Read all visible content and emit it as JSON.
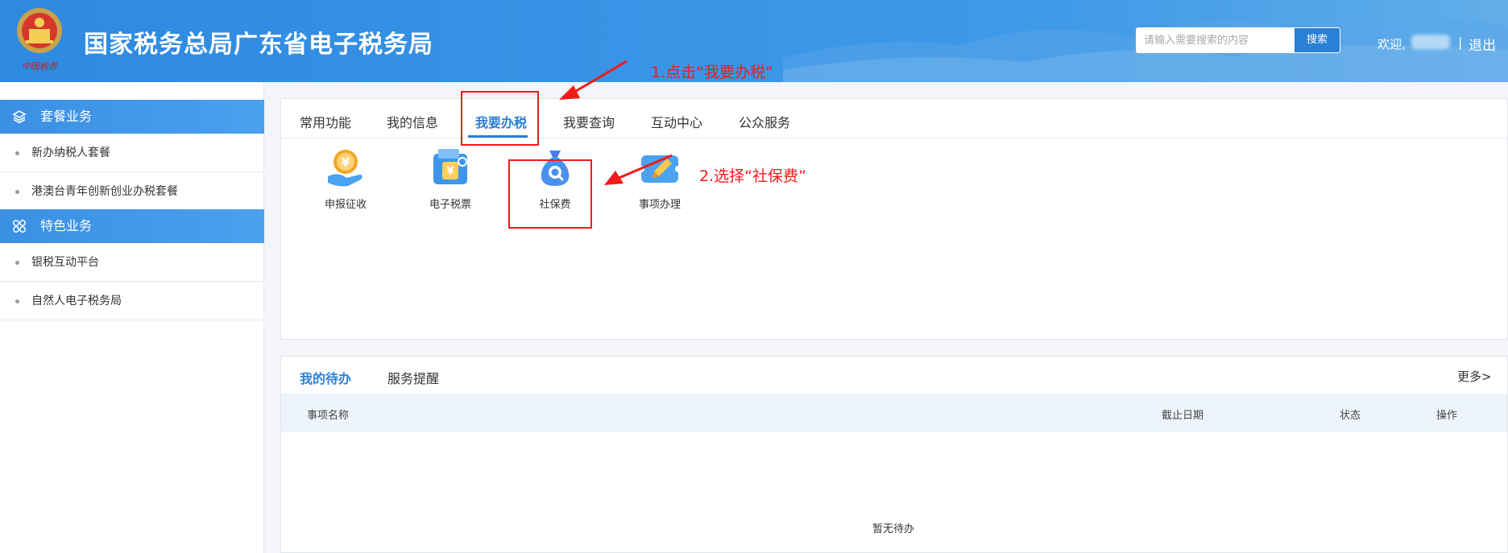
{
  "header": {
    "emblem_caption": "中国税务",
    "title": "国家税务总局广东省电子税务局",
    "search": {
      "placeholder": "请输入需要搜索的内容",
      "button_label": "搜索"
    },
    "welcome": "欢迎,",
    "separator": "|",
    "logout_label": "退出",
    "bg_color": "#3a94e6"
  },
  "sidebar": {
    "sections": [
      {
        "label": "套餐业务",
        "icon": "layers-icon",
        "items": [
          "新办纳税人套餐",
          "港澳台青年创新创业办税套餐"
        ]
      },
      {
        "label": "特色业务",
        "icon": "grid-icon",
        "items": [
          "银税互动平台",
          "自然人电子税务局"
        ]
      }
    ]
  },
  "main": {
    "tabs": [
      {
        "label": "常用功能",
        "active": false
      },
      {
        "label": "我的信息",
        "active": false
      },
      {
        "label": "我要办税",
        "active": true
      },
      {
        "label": "我要查询",
        "active": false
      },
      {
        "label": "互动中心",
        "active": false
      },
      {
        "label": "公众服务",
        "active": false
      }
    ],
    "functions": [
      {
        "label": "申报征收",
        "icon": "yuan-coin-hand-icon"
      },
      {
        "label": "电子税票",
        "icon": "tax-ticket-icon"
      },
      {
        "label": "社保费",
        "icon": "money-bag-search-icon"
      },
      {
        "label": "事项办理",
        "icon": "pencil-ticket-icon"
      }
    ]
  },
  "todo": {
    "tabs": [
      {
        "label": "我的待办",
        "active": true
      },
      {
        "label": "服务提醒",
        "active": false
      }
    ],
    "more_label": "更多>",
    "columns": [
      "事项名称",
      "截止日期",
      "状态",
      "操作"
    ],
    "empty_text": "暂无待办"
  },
  "annotations": {
    "step1": "1.点击“我要办税”",
    "step2": "2.选择“社保费”",
    "color": "#f01a1a"
  },
  "colors": {
    "accent": "#2a7fd6",
    "annotation": "#f01a1a"
  }
}
